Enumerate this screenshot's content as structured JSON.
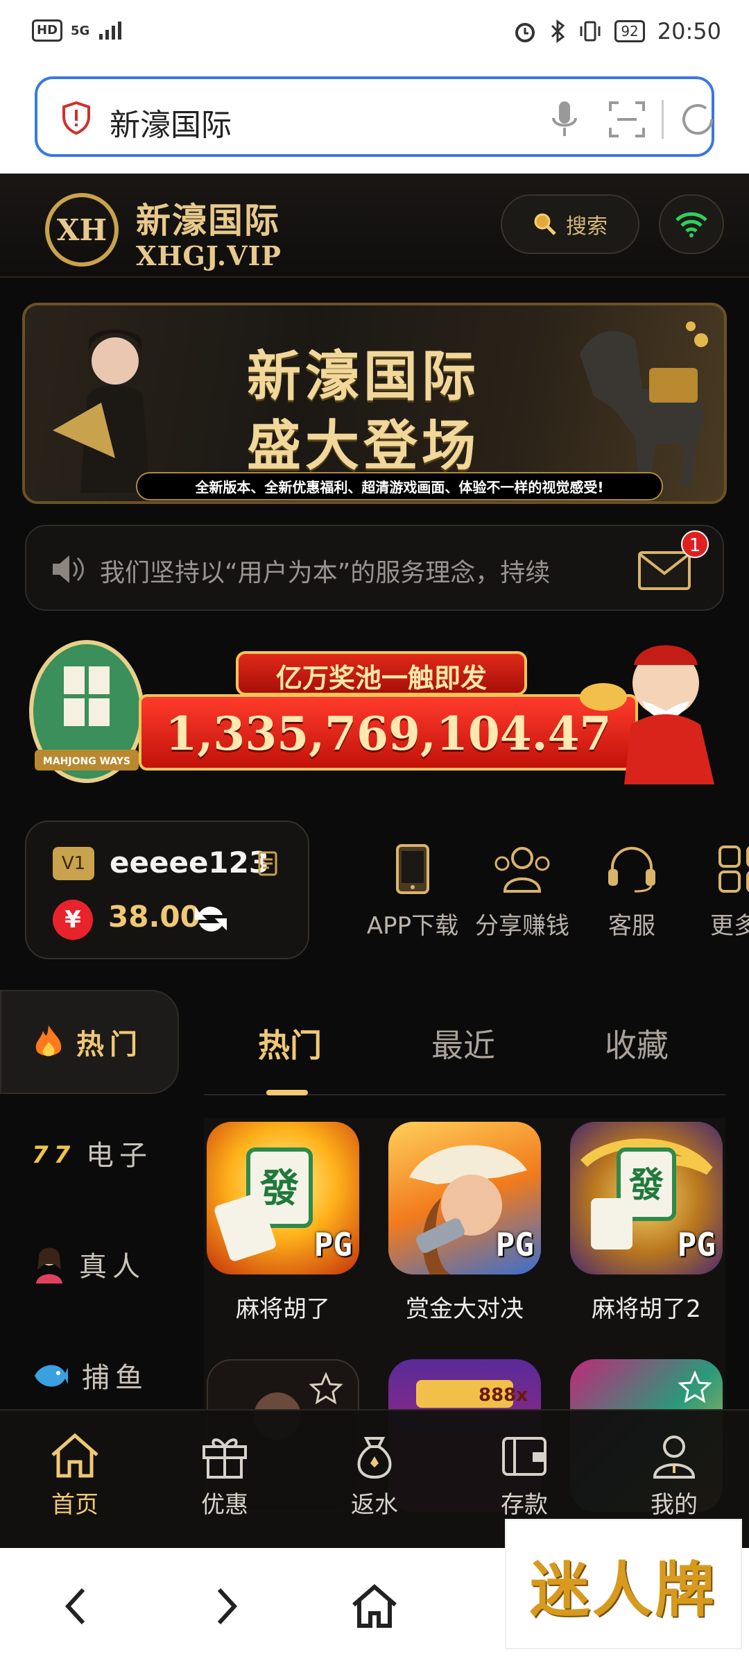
{
  "status_bar": {
    "network_hd": "HD",
    "network_gen": "5G",
    "battery": "92",
    "time": "20:50"
  },
  "address_bar": {
    "title": "新濠国际"
  },
  "header": {
    "logo_badge": "XH",
    "logo_cn": "新濠国际",
    "logo_en": "XHGJ.VIP",
    "search_label": "搜索"
  },
  "banner": {
    "headline_1": "新濠国际",
    "headline_2": "盛大登场",
    "subline": "全新版本、全新优惠福利、超清游戏画面、体验不一样的视觉感受!"
  },
  "notice": {
    "text": "我们坚持以“用户为本”的服务理念，持续",
    "mail_badge": "1"
  },
  "jackpot": {
    "title": "亿万奖池一触即发",
    "value": "1,335,769,104.47",
    "game_caption": "MAHJONG WAYS"
  },
  "user": {
    "vip": "V1",
    "username": "eeeee123",
    "currency_symbol": "¥",
    "balance": "38.00"
  },
  "quick_actions": [
    {
      "label": "APP下载",
      "icon": "phone-icon"
    },
    {
      "label": "分享赚钱",
      "icon": "people-icon"
    },
    {
      "label": "客服",
      "icon": "headset-icon"
    },
    {
      "label": "更多",
      "icon": "grid-icon"
    }
  ],
  "side_menu": [
    {
      "label": "热门",
      "icon": "fire-icon",
      "active": true
    },
    {
      "label": "电子",
      "icon": "slot-777-icon"
    },
    {
      "label": "真人",
      "icon": "dealer-icon"
    },
    {
      "label": "捕鱼",
      "icon": "fish-icon"
    }
  ],
  "tabs": [
    {
      "label": "热门",
      "active": true
    },
    {
      "label": "最近"
    },
    {
      "label": "收藏"
    }
  ],
  "games": [
    {
      "name": "麻将胡了",
      "provider": "PG"
    },
    {
      "name": "赏金大对决",
      "provider": "PG"
    },
    {
      "name": "麻将胡了2",
      "provider": "PG"
    }
  ],
  "games_row2_label": "888x",
  "bottom_nav": [
    {
      "label": "首页",
      "icon": "home-icon",
      "active": true
    },
    {
      "label": "优惠",
      "icon": "gift-icon"
    },
    {
      "label": "返水",
      "icon": "moneybag-icon"
    },
    {
      "label": "存款",
      "icon": "wallet-icon"
    },
    {
      "label": "我的",
      "icon": "user-icon"
    }
  ],
  "watermark": "迷人牌",
  "colors": {
    "gold": "#f0c875",
    "background": "#0b0b0b",
    "accent_blue": "#3a78e0",
    "red": "#e8232b"
  }
}
